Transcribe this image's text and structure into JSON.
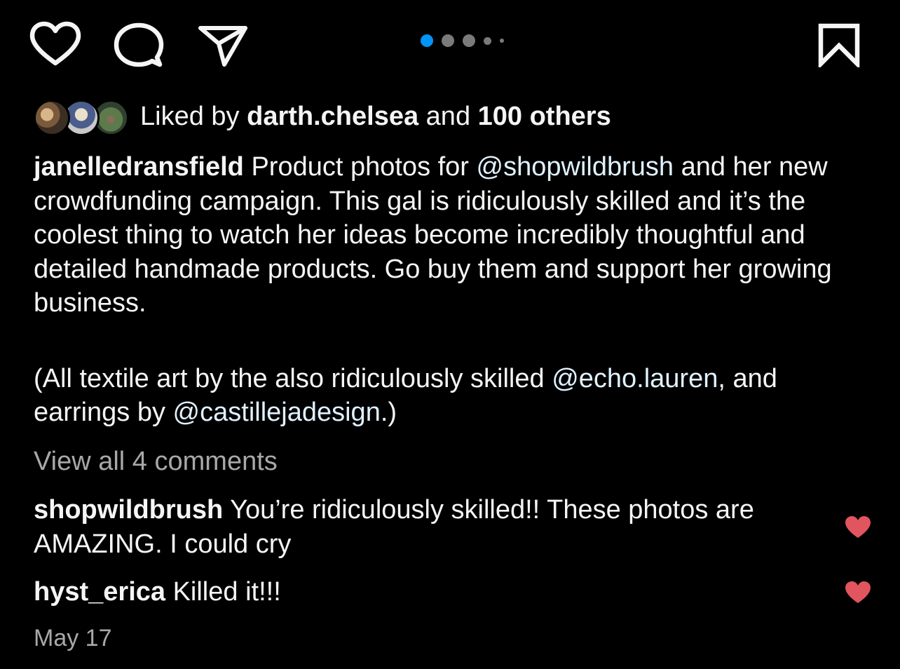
{
  "actions": {
    "like_icon": "heart-outline",
    "comment_icon": "speech-bubble",
    "share_icon": "paper-plane",
    "save_icon": "bookmark-outline",
    "carousel_dots": 5,
    "carousel_active_index": 0,
    "active_dot_color": "#0095f6"
  },
  "likes": {
    "prefix": "Liked by",
    "user": "darth.chelsea",
    "joiner": "and",
    "others": "100 others"
  },
  "caption": {
    "username": "janelledransfield",
    "part1": "Product photos for",
    "mention1": "@shopwildbrush",
    "part2": "and her new crowdfunding campaign. This gal is ridiculously skilled and it’s the coolest thing to watch her ideas become incredibly thoughtful and detailed handmade products. Go buy them and support her growing business.",
    "part3": "(All textile art by the also ridiculously skilled",
    "mention2": "@echo.lauren",
    "part4": ", and earrings by",
    "mention3": "@castillejadesign",
    "part5": ".)"
  },
  "view_all_comments": "View all 4 comments",
  "comments": [
    {
      "username": "shopwildbrush",
      "text": "You’re ridiculously skilled!! These photos are AMAZING. I could cry",
      "liked": true
    },
    {
      "username": "hyst_erica",
      "text": "Killed it!!!",
      "liked": true
    }
  ],
  "date": "May 17",
  "colors": {
    "background": "#000000",
    "text": "#f5f5f5",
    "secondary_text": "#a8a8a8",
    "mention": "#e0f1ff",
    "heart_liked": "#e0555e"
  }
}
